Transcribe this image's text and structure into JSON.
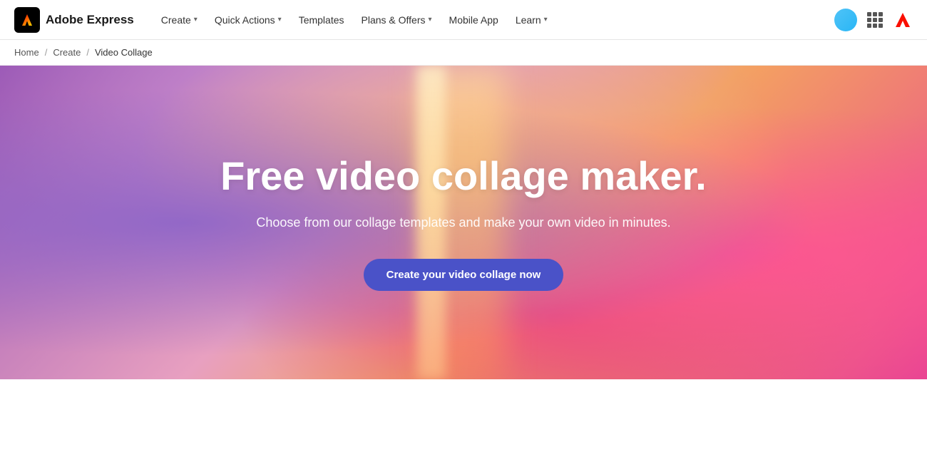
{
  "brand": {
    "name": "Adobe Express"
  },
  "nav": {
    "items": [
      {
        "label": "Create",
        "hasDropdown": true
      },
      {
        "label": "Quick Actions",
        "hasDropdown": true
      },
      {
        "label": "Templates",
        "hasDropdown": false
      },
      {
        "label": "Plans & Offers",
        "hasDropdown": true
      },
      {
        "label": "Mobile App",
        "hasDropdown": false
      },
      {
        "label": "Learn",
        "hasDropdown": true
      }
    ]
  },
  "breadcrumb": {
    "home": "Home",
    "create": "Create",
    "current": "Video Collage"
  },
  "hero": {
    "title": "Free video collage maker.",
    "subtitle": "Choose from our collage templates and make your own video in minutes.",
    "cta_label": "Create your video collage now"
  }
}
